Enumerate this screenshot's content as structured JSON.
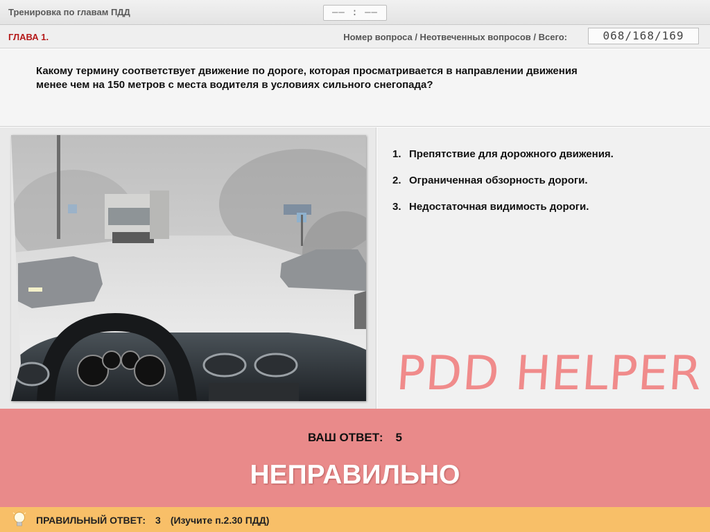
{
  "header": {
    "title": "Тренировка по главам ПДД",
    "timer": "—— : ——"
  },
  "chapter_bar": {
    "chapter": "ГЛАВА 1.",
    "counter_label": "Номер вопроса / Неотвеченных вопросов / Всего:",
    "counter": "068/168/169"
  },
  "question": {
    "text": "Какому термину соответствует движение по дороге, которая просматривается в направлении движения менее чем на 150 метров с места водителя в условиях сильного снегопада?"
  },
  "answers": [
    {
      "num": "1.",
      "text": "Препятствие для дорожного движения."
    },
    {
      "num": "2.",
      "text": "Ограниченная обзорность дороги."
    },
    {
      "num": "3.",
      "text": "Недостаточная видимость дороги."
    }
  ],
  "watermark": "PDD HELPER",
  "result": {
    "your_label": "ВАШ  ОТВЕТ:",
    "your_value": "5",
    "verdict": "НЕПРАВИЛЬНО",
    "color": "#e98a8a"
  },
  "footer": {
    "icon": "lightbulb-icon",
    "correct_label": "ПРАВИЛЬНЫЙ ОТВЕТ:",
    "correct_value": "3",
    "hint": "(Изучите п.2.30 ПДД)",
    "color": "#f8bf68"
  }
}
